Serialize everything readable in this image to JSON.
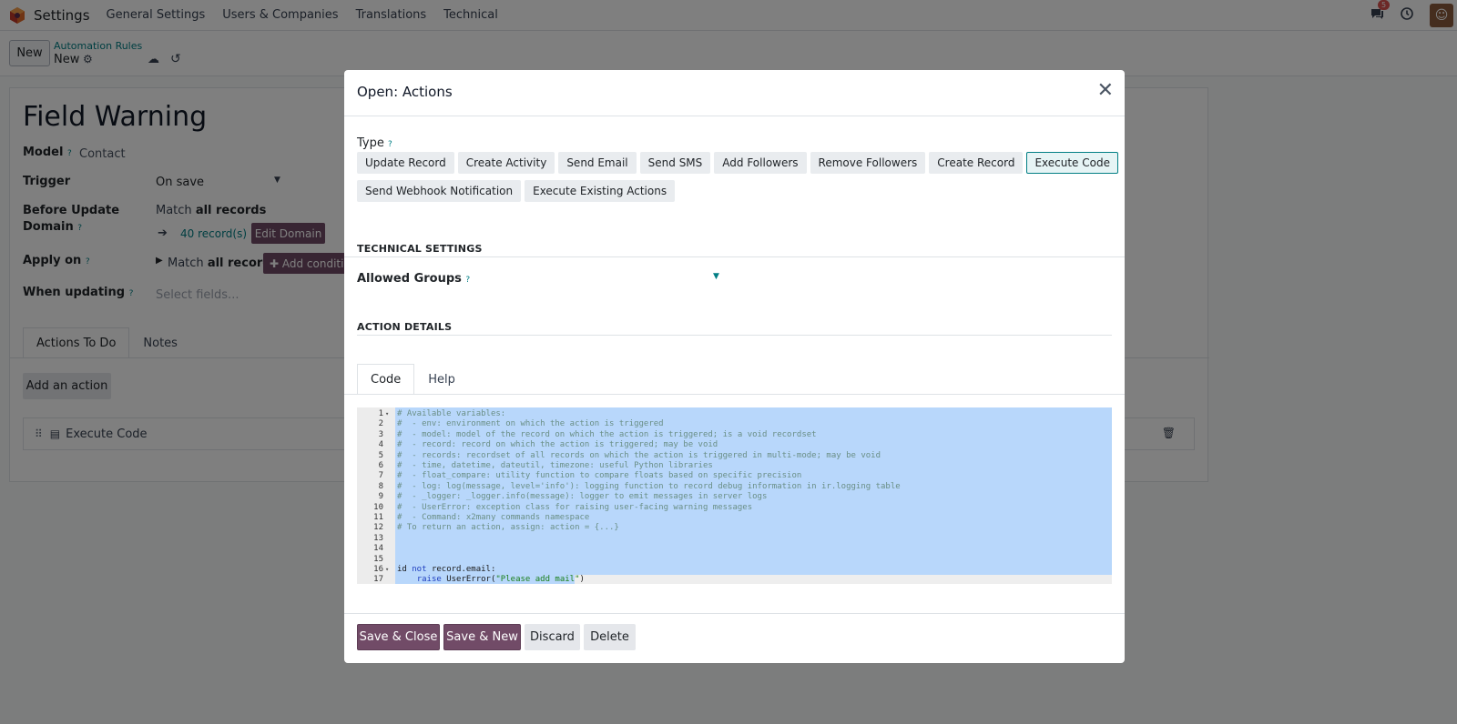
{
  "navbar": {
    "app_name": "Settings",
    "menu": [
      "General Settings",
      "Users & Companies",
      "Translations",
      "Technical"
    ],
    "chat_badge": "5"
  },
  "control_panel": {
    "new_label": "New",
    "breadcrumb_parent": "Automation Rules",
    "breadcrumb_current": "New"
  },
  "form": {
    "title": "Field Warning",
    "model_label": "Model",
    "model_value": "Contact",
    "trigger_label": "Trigger",
    "trigger_value": "On save",
    "before_update_label_1": "Before Update",
    "before_update_label_2": "Domain",
    "match_prefix": "Match",
    "match_bold": "all records",
    "records_count": "40 record(s)",
    "edit_domain_label": "Edit Domain",
    "apply_on_label": "Apply on",
    "apply_match_prefix": "Match",
    "apply_match_bold": "all records",
    "add_condition_label": "Add conditio",
    "when_updating_label": "When updating",
    "when_updating_placeholder": "Select fields...",
    "tabs": [
      "Actions To Do",
      "Notes"
    ],
    "add_action_label": "Add an action",
    "action_row_name": "Execute Code"
  },
  "modal": {
    "title": "Open: Actions",
    "type_label": "Type",
    "type_buttons_row1": [
      "Update Record",
      "Create Activity",
      "Send Email",
      "Send SMS",
      "Add Followers",
      "Remove Followers",
      "Create Record",
      "Execute Code"
    ],
    "type_buttons_row2": [
      "Send Webhook Notification",
      "Execute Existing Actions"
    ],
    "active_type": "Execute Code",
    "technical_settings_title": "TECHNICAL SETTINGS",
    "allowed_groups_label": "Allowed Groups",
    "action_details_title": "ACTION DETAILS",
    "tabs": [
      "Code",
      "Help"
    ],
    "code_lines": [
      "# Available variables:",
      "#  - env: environment on which the action is triggered",
      "#  - model: model of the record on which the action is triggered; is a void recordset",
      "#  - record: record on which the action is triggered; may be void",
      "#  - records: recordset of all records on which the action is triggered in multi-mode; may be void",
      "#  - time, datetime, dateutil, timezone: useful Python libraries",
      "#  - float_compare: utility function to compare floats based on specific precision",
      "#  - log: log(message, level='info'): logging function to record debug information in ir.logging table",
      "#  - _logger: _logger.info(message): logger to emit messages in server logs",
      "#  - UserError: exception class for raising user-facing warning messages",
      "#  - Command: x2many commands namespace",
      "# To return an action, assign: action = {...}",
      "",
      "",
      "",
      "id not record.email:",
      "    raise UserError(\"Please add mail\")"
    ],
    "footer": {
      "save_close": "Save & Close",
      "save_new": "Save & New",
      "discard": "Discard",
      "delete": "Delete"
    }
  }
}
